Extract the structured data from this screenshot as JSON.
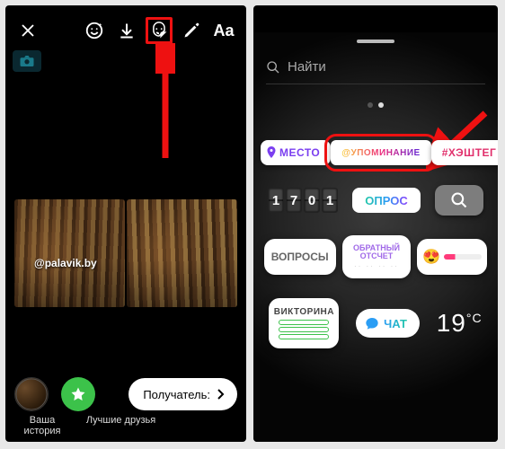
{
  "left": {
    "toolbar": {
      "text_tool": "Aa"
    },
    "camera_chip": true,
    "mention": "@palavik.by",
    "bottom": {
      "your_story": "Ваша история",
      "best_friends": "Лучшие друзья",
      "recipient": "Получатель:"
    }
  },
  "right": {
    "search": {
      "placeholder": "Найти"
    },
    "row1": {
      "location": "МЕСТО",
      "mention": "@УПОМИНАНИЕ",
      "hashtag": "#ХЭШТЕГ"
    },
    "row2": {
      "time_digits": [
        "1",
        "7",
        "0",
        "1"
      ],
      "poll": "ОПРОС"
    },
    "row3": {
      "questions": "ВОПРОСЫ",
      "countdown": "ОБРАТНЫЙ ОТСЧЕТ",
      "emoji": "😍"
    },
    "row4": {
      "quiz": "ВИКТОРИНА",
      "chat": "ЧАТ",
      "temperature": "19",
      "temperature_unit": "°C"
    }
  }
}
